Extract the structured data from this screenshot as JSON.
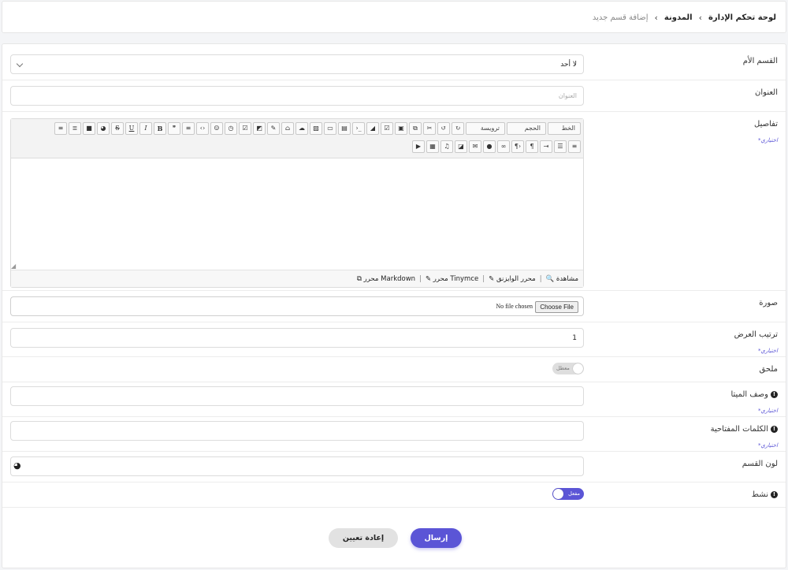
{
  "breadcrumb": {
    "items": [
      "لوحة تحكم الإدارة",
      "المدونة"
    ],
    "current": "إضافة قسم جديد"
  },
  "form": {
    "optional_text": "*اختياري",
    "parent": {
      "label": "القسم الأم",
      "value": "لا أحد"
    },
    "title": {
      "label": "العنوان",
      "placeholder": "العنوان"
    },
    "details": {
      "label": "تفاصيل",
      "toolbar": {
        "font": "الخط",
        "size": "الحجم",
        "heading": "ترويسة",
        "icons_row1": [
          "redo-icon",
          "undo-icon",
          "cut-icon",
          "copy-icon",
          "paste-icon",
          "paste-text-icon",
          "eraser-icon",
          "code-icon",
          "file-icon",
          "box-icon",
          "image-icon",
          "upload-icon",
          "basket-icon",
          "pencil-icon",
          "edit-icon",
          "checkbox-icon",
          "history-icon",
          "smile-icon",
          "tag-code-icon",
          "list-icon",
          "quote-icon",
          "bold-icon",
          "italic-icon",
          "underline-icon",
          "strike-icon",
          "palette-icon",
          "square-icon",
          "align-right-icon",
          "align-center-icon"
        ],
        "icons_row2": [
          "align-left-icon",
          "justify-icon",
          "indent-icon",
          "rtl-icon",
          "ltr-icon",
          "link-icon",
          "chat-icon",
          "mail-icon",
          "expand-icon",
          "music-icon",
          "video-icon",
          "youtube-icon"
        ]
      },
      "modes": [
        {
          "icon": "search-icon",
          "label": "مشاهدة"
        },
        {
          "icon": "edit-icon",
          "label": "محرر الوايزنق"
        },
        {
          "icon": "edit-icon",
          "label": "محرر Tinymce"
        },
        {
          "icon": "windows-icon",
          "label": "محرر Markdown"
        }
      ]
    },
    "image": {
      "label": "صورة",
      "button": "Choose File",
      "status": "No file chosen"
    },
    "order": {
      "label": "ترتيب العرض",
      "value": "1"
    },
    "pinned": {
      "label": "ملحق",
      "toggle": "معطل"
    },
    "meta_description": {
      "label": "وصف الميتا"
    },
    "meta_keywords": {
      "label": "الكلمات المفتاحية"
    },
    "color": {
      "label": "لون القسم"
    },
    "active": {
      "label": "نشط",
      "toggle": "مفعل"
    },
    "submit": "إرسال",
    "reset": "إعادة تعيين"
  }
}
